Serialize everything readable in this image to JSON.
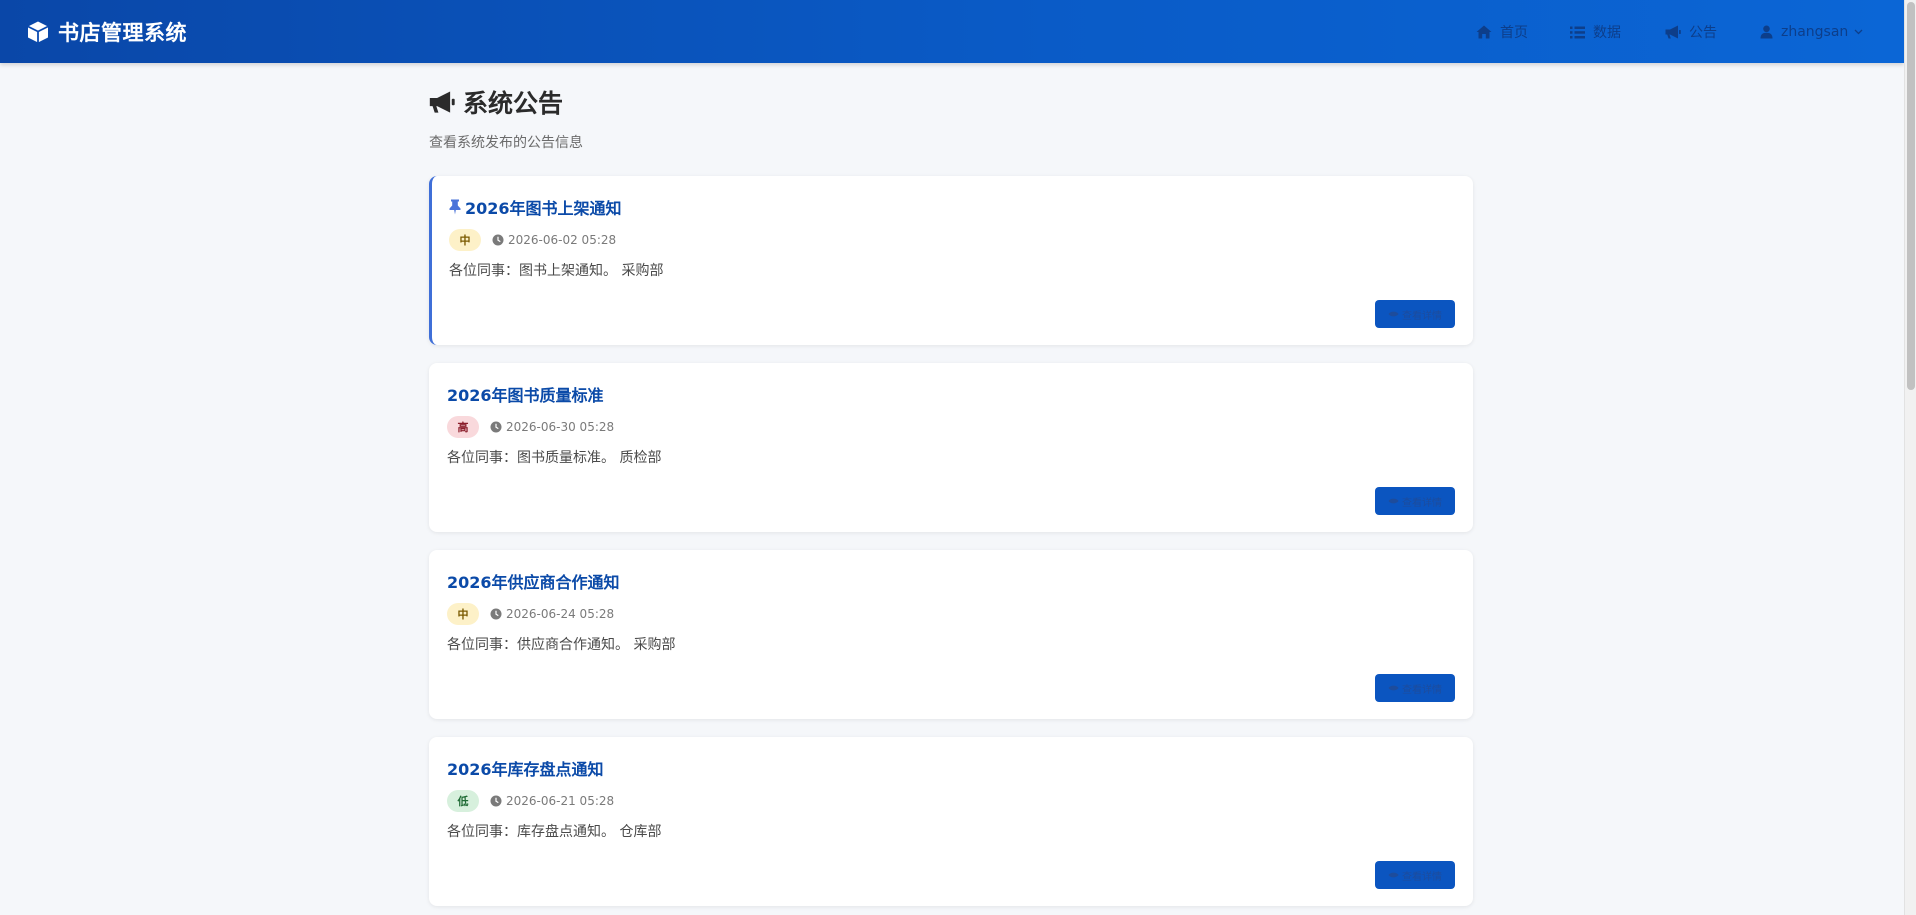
{
  "navbar": {
    "brand": "书店管理系统",
    "brand_icon": "cube-icon",
    "items": [
      {
        "label": "首页",
        "icon": "home-icon"
      },
      {
        "label": "数据",
        "icon": "list-icon"
      },
      {
        "label": "公告",
        "icon": "bullhorn-icon"
      }
    ],
    "user": {
      "name": "zhangsan",
      "icon": "user-icon"
    }
  },
  "page": {
    "title": "系统公告",
    "title_icon": "bullhorn-icon",
    "subtitle": "查看系统发布的公告信息"
  },
  "colors": {
    "navbar_start": "#0a47a8",
    "navbar_end": "#0b66d6",
    "title_blue": "#0b4aa8",
    "button_blue": "#0b55c0",
    "pinned_border": "#3f6fd8",
    "priority_mid_bg": "#fdf1c8",
    "priority_high_bg": "#f9d9dc",
    "priority_low_bg": "#d7f0dd"
  },
  "notices": [
    {
      "title": "2026年图书上架通知",
      "pinned": true,
      "priority": "中",
      "time": "2026-06-02 05:28",
      "content": "各位同事：图书上架通知。 采购部",
      "button": "查看详情"
    },
    {
      "title": "2026年图书质量标准",
      "pinned": false,
      "priority": "高",
      "time": "2026-06-30 05:28",
      "content": "各位同事：图书质量标准。 质检部",
      "button": "查看详情"
    },
    {
      "title": "2026年供应商合作通知",
      "pinned": false,
      "priority": "中",
      "time": "2026-06-24 05:28",
      "content": "各位同事：供应商合作通知。 采购部",
      "button": "查看详情"
    },
    {
      "title": "2026年库存盘点通知",
      "pinned": false,
      "priority": "低",
      "time": "2026-06-21 05:28",
      "content": "各位同事：库存盘点通知。 仓库部",
      "button": "查看详情"
    }
  ]
}
